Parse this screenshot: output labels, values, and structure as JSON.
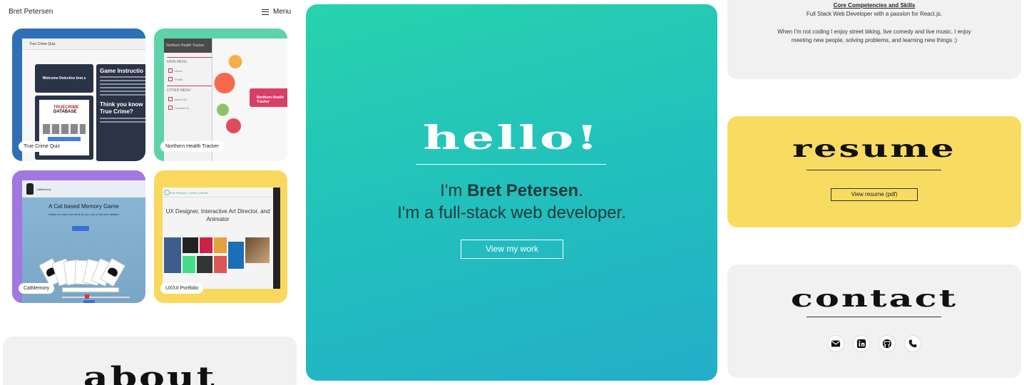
{
  "nav": {
    "brand": "Bret Petersen",
    "menu_label": "Menu"
  },
  "projects": [
    {
      "label": "True Crime Quiz",
      "tab_title": "True Crime Quiz",
      "welcome": "Welcome Detective bret.s",
      "instructions_title": "Game Instructio",
      "brand_a": "TRUECRIME",
      "brand_b": "DATABASE",
      "question": "Think you know True Crime?"
    },
    {
      "label": "Northern Health Tracker",
      "tab_title": "Northern Health Tracker",
      "main_menu": "MAIN MENU",
      "other_menu": "OTHER MENU",
      "items": [
        "Home",
        "Profile",
        "About Us",
        "Contact Us"
      ],
      "ribbon": "Northern Health Tracker"
    },
    {
      "label": "CatMemory",
      "app_name": "CatMemory",
      "headline": "A Cat based Memory Game",
      "sub": "Match as many cat cards as you can in the time allotted"
    },
    {
      "label": "UX/UI Portfolio",
      "site_name": "Bret Petersen | online portfolio",
      "headline": "UX Designer, Interactive Art Director, and Animator"
    }
  ],
  "about": {
    "title": "about"
  },
  "hero": {
    "greeting": "hello!",
    "intro_prefix": "I'm ",
    "name": "Bret Petersen",
    "intro_suffix": ".",
    "tagline": "I'm a full-stack web developer.",
    "cta": "View my work"
  },
  "competencies": {
    "title": "Core Competencies and Skills",
    "line": "Full Stack Web Developer with a passion for React.js.",
    "paragraph": "When I'm not coding I enjoy street biking, live comedy and live music. I enjoy meeting new people, solving problems, and learning new things :)"
  },
  "resume": {
    "title": "resume",
    "button": "View resume (pdf)"
  },
  "contact": {
    "title": "contact",
    "icons": [
      "email-icon",
      "linkedin-icon",
      "github-icon",
      "phone-icon"
    ]
  },
  "colors": {
    "hero_start": "#27d3ad",
    "hero_end": "#22aec9",
    "resume_bg": "#f8dc62",
    "panel_bg": "#f1f1f1",
    "card_blue": "#2f6fb6",
    "card_green": "#5fd3a8",
    "card_purple": "#a177e0",
    "card_yellow": "#f8d95e"
  }
}
